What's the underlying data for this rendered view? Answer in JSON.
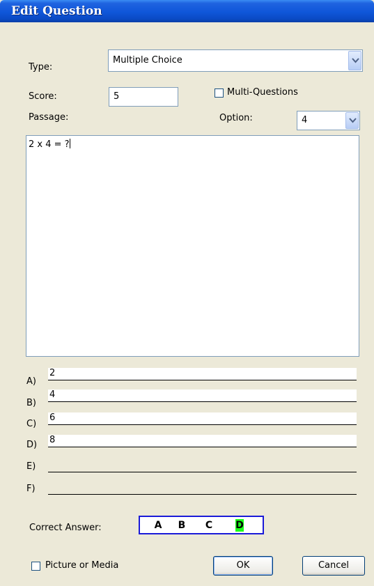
{
  "dialog": {
    "title": "Edit Question"
  },
  "type": {
    "label": "Type:",
    "value": "Multiple Choice"
  },
  "score": {
    "label": "Score:",
    "value": "5"
  },
  "multi_questions": {
    "label": "Multi-Questions",
    "checked": false
  },
  "passage": {
    "label": "Passage:",
    "text": "2 x 4 = ?"
  },
  "option": {
    "label": "Option:",
    "value": "4"
  },
  "options": [
    {
      "letter": "A)",
      "value": "2"
    },
    {
      "letter": "B)",
      "value": "4"
    },
    {
      "letter": "C)",
      "value": "6"
    },
    {
      "letter": "D)",
      "value": "8"
    },
    {
      "letter": "E)",
      "value": ""
    },
    {
      "letter": "F)",
      "value": ""
    }
  ],
  "correct_answer": {
    "label": "Correct Answer:",
    "choices": [
      "A",
      "B",
      "C",
      "D"
    ],
    "selected": "D",
    "selected_color": "#1aff1a"
  },
  "picture_or_media": {
    "label": "Picture or Media",
    "checked": false
  },
  "buttons": {
    "ok": "OK",
    "cancel": "Cancel"
  },
  "colors": {
    "titlebar": "#0f56d9",
    "background": "#ece9d8",
    "answer_border": "#1a1ad8"
  }
}
